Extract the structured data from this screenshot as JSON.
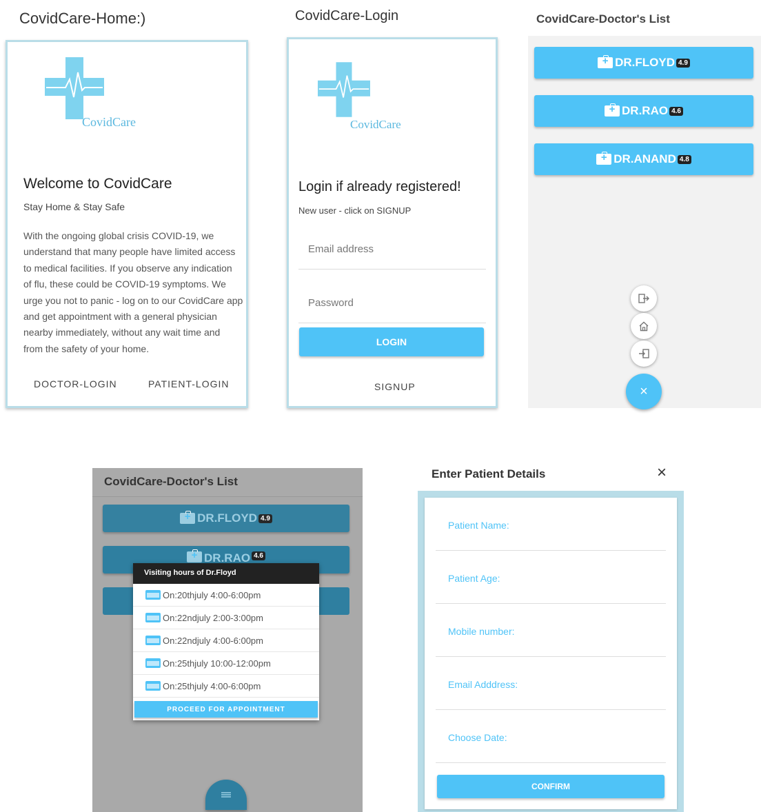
{
  "home": {
    "title": "CovidCare-Home:)",
    "logo_text": "CovidCare",
    "heading": "Welcome to CovidCare",
    "subheading": "Stay Home & Stay Safe",
    "body_lines": [
      "With the ongoing global crisis COVID-19, we",
      "understand that many people have limited access",
      "to medical facilities. If you observe any indication",
      "of flu, these could be COVID-19 symptoms. We",
      "urge you not to panic - log on to our CovidCare app",
      "and get appointment with a general physician",
      "nearby immediately, without any wait time and",
      "from the safety of your home."
    ],
    "doctor_login": "DOCTOR-LOGIN",
    "patient_login": "PATIENT-LOGIN"
  },
  "login": {
    "title": "CovidCare-Login",
    "logo_text": "CovidCare",
    "heading": "Login if already registered!",
    "subheading": "New user - click on SIGNUP",
    "email_placeholder": "Email address",
    "password_placeholder": "Password",
    "login_label": "LOGIN",
    "signup_label": "SIGNUP"
  },
  "doctor_list": {
    "title": "CovidCare-Doctor's List",
    "doctors": [
      {
        "name": "DR.FLOYD",
        "rating": "4.9"
      },
      {
        "name": "DR.RAO",
        "rating": "4.6"
      },
      {
        "name": "DR.ANAND",
        "rating": "4.8"
      }
    ],
    "close_glyph": "×"
  },
  "visiting": {
    "title": "CovidCare-Doctor's List",
    "doctors": [
      {
        "name": "DR.FLOYD",
        "rating": "4.9"
      },
      {
        "name": "DR.RAO",
        "rating": "4.6"
      }
    ],
    "popup_title": "Visiting hours of Dr.Floyd",
    "slots": [
      "On:20thjuly 4:00-6:00pm",
      "On:22ndjuly 2:00-3:00pm",
      "On:22ndjuly 4:00-6:00pm",
      "On:25thjuly 10:00-12:00pm",
      "On:25thjuly 4:00-6:00pm"
    ],
    "proceed_label": "PROCEED FOR APPOINTMENT"
  },
  "patient": {
    "title": "Enter Patient Details",
    "close_glyph": "×",
    "fields": [
      "Patient Name:",
      "Patient Age:",
      "Mobile number:",
      "Email Adddress:",
      "Choose Date:"
    ],
    "confirm_label": "CONFIRM"
  },
  "colors": {
    "accent": "#4fc3f7",
    "logo": "#5bb8df",
    "card_border": "#b9dde8"
  }
}
